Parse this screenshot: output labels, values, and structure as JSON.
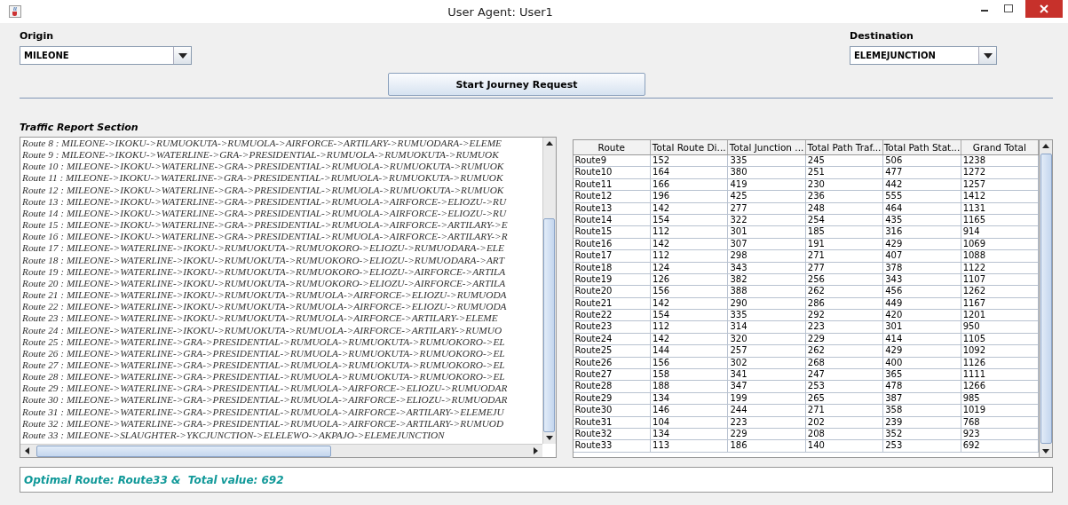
{
  "window": {
    "title": "User Agent: User1"
  },
  "origin": {
    "label": "Origin",
    "value": "MILEONE"
  },
  "destination": {
    "label": "Destination",
    "value": "ELEMEJUNCTION"
  },
  "start_button": "Start Journey Request",
  "traffic_report": {
    "title": "Traffic Report Section",
    "routes": [
      "Route 8 : MILEONE->IKOKU->RUMUOKUTA->RUMUOLA->AIRFORCE->ARTILARY->RUMUODARA->ELEME",
      "Route 9 : MILEONE->IKOKU->WATERLINE->GRA->PRESIDENTIAL->RUMUOLA->RUMUOKUTA->RUMUOK",
      "Route 10 : MILEONE->IKOKU->WATERLINE->GRA->PRESIDENTIAL->RUMUOLA->RUMUOKUTA->RUMUOK",
      "Route 11 : MILEONE->IKOKU->WATERLINE->GRA->PRESIDENTIAL->RUMUOLA->RUMUOKUTA->RUMUOK",
      "Route 12 : MILEONE->IKOKU->WATERLINE->GRA->PRESIDENTIAL->RUMUOLA->RUMUOKUTA->RUMUOK",
      "Route 13 : MILEONE->IKOKU->WATERLINE->GRA->PRESIDENTIAL->RUMUOLA->AIRFORCE->ELIOZU->RU",
      "Route 14 : MILEONE->IKOKU->WATERLINE->GRA->PRESIDENTIAL->RUMUOLA->AIRFORCE->ELIOZU->RU",
      "Route 15 : MILEONE->IKOKU->WATERLINE->GRA->PRESIDENTIAL->RUMUOLA->AIRFORCE->ARTILARY->E",
      "Route 16 : MILEONE->IKOKU->WATERLINE->GRA->PRESIDENTIAL->RUMUOLA->AIRFORCE->ARTILARY->R",
      "Route 17 : MILEONE->WATERLINE->IKOKU->RUMUOKUTA->RUMUOKORO->ELIOZU->RUMUODARA->ELE",
      "Route 18 : MILEONE->WATERLINE->IKOKU->RUMUOKUTA->RUMUOKORO->ELIOZU->RUMUODARA->ART",
      "Route 19 : MILEONE->WATERLINE->IKOKU->RUMUOKUTA->RUMUOKORO->ELIOZU->AIRFORCE->ARTILA",
      "Route 20 : MILEONE->WATERLINE->IKOKU->RUMUOKUTA->RUMUOKORO->ELIOZU->AIRFORCE->ARTILA",
      "Route 21 : MILEONE->WATERLINE->IKOKU->RUMUOKUTA->RUMUOLA->AIRFORCE->ELIOZU->RUMUODA",
      "Route 22 : MILEONE->WATERLINE->IKOKU->RUMUOKUTA->RUMUOLA->AIRFORCE->ELIOZU->RUMUODA",
      "Route 23 : MILEONE->WATERLINE->IKOKU->RUMUOKUTA->RUMUOLA->AIRFORCE->ARTILARY->ELEME",
      "Route 24 : MILEONE->WATERLINE->IKOKU->RUMUOKUTA->RUMUOLA->AIRFORCE->ARTILARY->RUMUO",
      "Route 25 : MILEONE->WATERLINE->GRA->PRESIDENTIAL->RUMUOLA->RUMUOKUTA->RUMUOKORO->EL",
      "Route 26 : MILEONE->WATERLINE->GRA->PRESIDENTIAL->RUMUOLA->RUMUOKUTA->RUMUOKORO->EL",
      "Route 27 : MILEONE->WATERLINE->GRA->PRESIDENTIAL->RUMUOLA->RUMUOKUTA->RUMUOKORO->EL",
      "Route 28 : MILEONE->WATERLINE->GRA->PRESIDENTIAL->RUMUOLA->RUMUOKUTA->RUMUOKORO->EL",
      "Route 29 : MILEONE->WATERLINE->GRA->PRESIDENTIAL->RUMUOLA->AIRFORCE->ELIOZU->RUMUODAR",
      "Route 30 : MILEONE->WATERLINE->GRA->PRESIDENTIAL->RUMUOLA->AIRFORCE->ELIOZU->RUMUODAR",
      "Route 31 : MILEONE->WATERLINE->GRA->PRESIDENTIAL->RUMUOLA->AIRFORCE->ARTILARY->ELEMEJU",
      "Route 32 : MILEONE->WATERLINE->GRA->PRESIDENTIAL->RUMUOLA->AIRFORCE->ARTILARY->RUMUOD",
      "Route 33 : MILEONE->SLAUGHTER->YKCJUNCTION->ELELEWO->AKPAJO->ELEMEJUNCTION"
    ]
  },
  "table": {
    "columns": [
      "Route",
      "Total Route Di...",
      "Total Junction ...",
      "Total Path Traf...",
      "Total Path Stat...",
      "Grand Total"
    ],
    "rows": [
      [
        "Route9",
        "152",
        "335",
        "245",
        "506",
        "1238"
      ],
      [
        "Route10",
        "164",
        "380",
        "251",
        "477",
        "1272"
      ],
      [
        "Route11",
        "166",
        "419",
        "230",
        "442",
        "1257"
      ],
      [
        "Route12",
        "196",
        "425",
        "236",
        "555",
        "1412"
      ],
      [
        "Route13",
        "142",
        "277",
        "248",
        "464",
        "1131"
      ],
      [
        "Route14",
        "154",
        "322",
        "254",
        "435",
        "1165"
      ],
      [
        "Route15",
        "112",
        "301",
        "185",
        "316",
        "914"
      ],
      [
        "Route16",
        "142",
        "307",
        "191",
        "429",
        "1069"
      ],
      [
        "Route17",
        "112",
        "298",
        "271",
        "407",
        "1088"
      ],
      [
        "Route18",
        "124",
        "343",
        "277",
        "378",
        "1122"
      ],
      [
        "Route19",
        "126",
        "382",
        "256",
        "343",
        "1107"
      ],
      [
        "Route20",
        "156",
        "388",
        "262",
        "456",
        "1262"
      ],
      [
        "Route21",
        "142",
        "290",
        "286",
        "449",
        "1167"
      ],
      [
        "Route22",
        "154",
        "335",
        "292",
        "420",
        "1201"
      ],
      [
        "Route23",
        "112",
        "314",
        "223",
        "301",
        "950"
      ],
      [
        "Route24",
        "142",
        "320",
        "229",
        "414",
        "1105"
      ],
      [
        "Route25",
        "144",
        "257",
        "262",
        "429",
        "1092"
      ],
      [
        "Route26",
        "156",
        "302",
        "268",
        "400",
        "1126"
      ],
      [
        "Route27",
        "158",
        "341",
        "247",
        "365",
        "1111"
      ],
      [
        "Route28",
        "188",
        "347",
        "253",
        "478",
        "1266"
      ],
      [
        "Route29",
        "134",
        "199",
        "265",
        "387",
        "985"
      ],
      [
        "Route30",
        "146",
        "244",
        "271",
        "358",
        "1019"
      ],
      [
        "Route31",
        "104",
        "223",
        "202",
        "239",
        "768"
      ],
      [
        "Route32",
        "134",
        "229",
        "208",
        "352",
        "923"
      ],
      [
        "Route33",
        "113",
        "186",
        "140",
        "253",
        "692"
      ]
    ]
  },
  "result": "Optimal Route: Route33 &  Total value: 692"
}
